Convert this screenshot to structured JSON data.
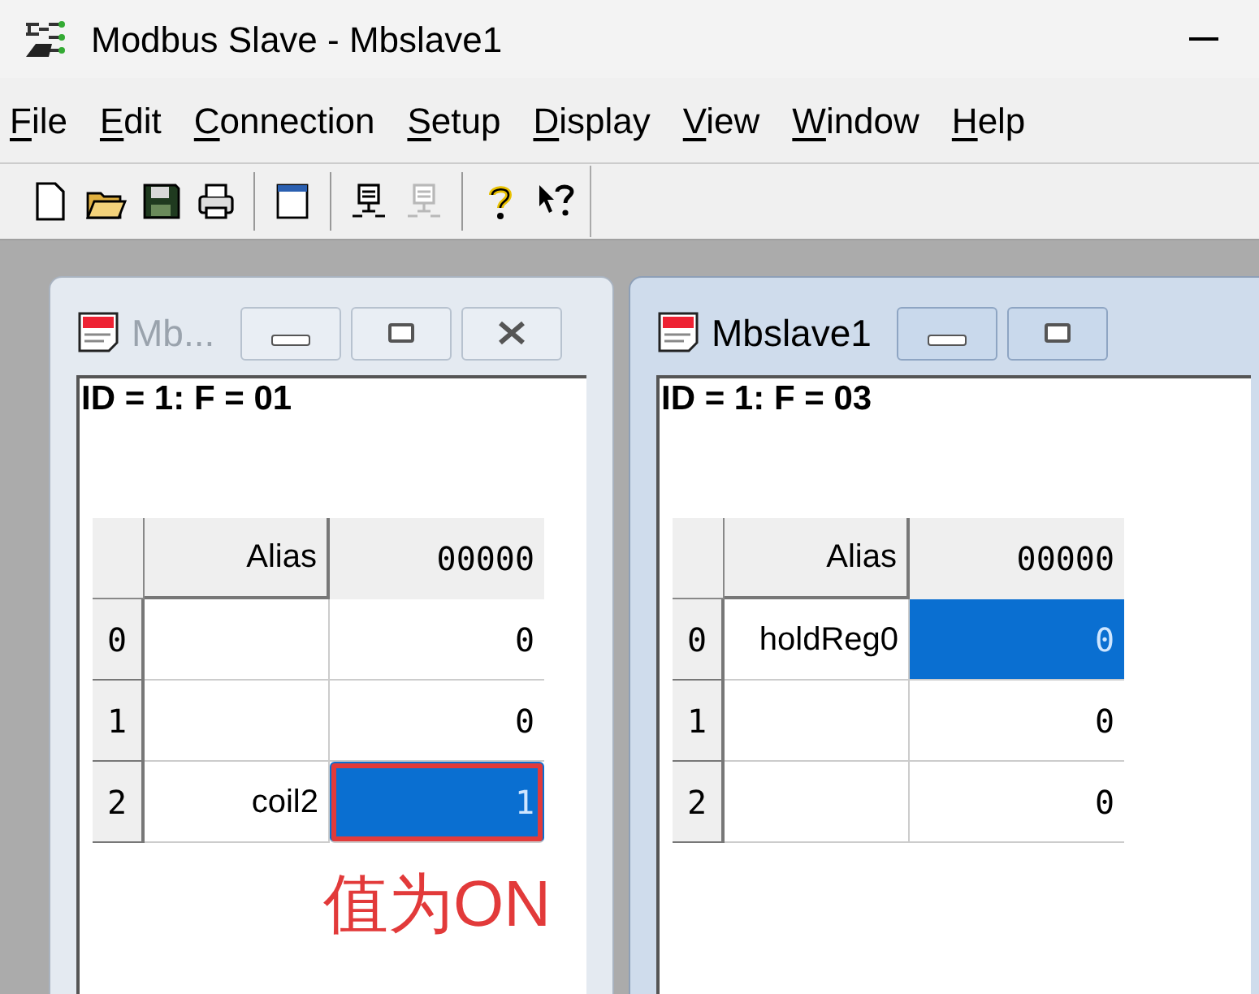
{
  "window": {
    "title": "Modbus Slave - Mbslave1"
  },
  "menu": [
    {
      "label": "File"
    },
    {
      "label": "Edit"
    },
    {
      "label": "Connection"
    },
    {
      "label": "Setup"
    },
    {
      "label": "Display"
    },
    {
      "label": "View"
    },
    {
      "label": "Window"
    },
    {
      "label": "Help"
    }
  ],
  "toolbar": [
    {
      "kind": "new",
      "disabled": false
    },
    {
      "kind": "open",
      "disabled": false
    },
    {
      "kind": "save",
      "disabled": false
    },
    {
      "kind": "print",
      "disabled": false
    },
    {
      "kind": "sep"
    },
    {
      "kind": "window",
      "disabled": false
    },
    {
      "kind": "sep"
    },
    {
      "kind": "connect",
      "disabled": false
    },
    {
      "kind": "disconnect",
      "disabled": true
    },
    {
      "kind": "sep"
    },
    {
      "kind": "help",
      "disabled": false
    },
    {
      "kind": "context-help",
      "disabled": false
    }
  ],
  "documents": [
    {
      "title": "Mb...",
      "active": false,
      "buttons": [
        {
          "kind": "minimize"
        },
        {
          "kind": "maximize"
        },
        {
          "kind": "close"
        }
      ],
      "info": "ID = 1: F = 01",
      "columns": [
        "Alias",
        "00000"
      ],
      "rows": [
        {
          "index": "0",
          "alias": "",
          "value": "0",
          "selected": false,
          "marked": false
        },
        {
          "index": "1",
          "alias": "",
          "value": "0",
          "selected": false,
          "marked": false
        },
        {
          "index": "2",
          "alias": "coil2",
          "value": "1",
          "selected": true,
          "marked": true
        }
      ],
      "annotation": "值为ON"
    },
    {
      "title": "Mbslave1",
      "active": true,
      "buttons": [
        {
          "kind": "minimize"
        },
        {
          "kind": "maximize"
        }
      ],
      "info": "ID = 1: F = 03",
      "columns": [
        "Alias",
        "00000"
      ],
      "rows": [
        {
          "index": "0",
          "alias": "holdReg0",
          "value": "0",
          "selected": true,
          "marked": false
        },
        {
          "index": "1",
          "alias": "",
          "value": "0",
          "selected": false,
          "marked": false
        },
        {
          "index": "2",
          "alias": "",
          "value": "0",
          "selected": false,
          "marked": false
        }
      ]
    }
  ]
}
